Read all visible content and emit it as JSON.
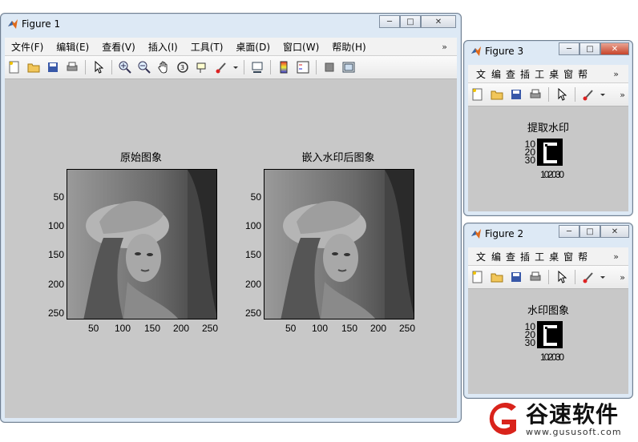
{
  "fig1": {
    "title": "Figure 1",
    "menu": [
      "文件(F)",
      "编辑(E)",
      "查看(V)",
      "插入(I)",
      "工具(T)",
      "桌面(D)",
      "窗口(W)",
      "帮助(H)"
    ],
    "menu_more": "»",
    "axes_left_title": "原始图象",
    "axes_right_title": "嵌入水印后图象",
    "y_ticks": [
      "50",
      "100",
      "150",
      "200",
      "250"
    ],
    "x_ticks": [
      "50",
      "100",
      "150",
      "200",
      "250"
    ]
  },
  "fig3": {
    "title": "Figure 3",
    "menu": [
      "文",
      "编",
      "查",
      "插",
      "工",
      "桌",
      "窗",
      "帮"
    ],
    "menu_more": "»",
    "toolbar_more": "»",
    "axes_title": "提取水印",
    "y_ticks": [
      "10",
      "20",
      "30"
    ],
    "x_ticks": "102030"
  },
  "fig2": {
    "title": "Figure 2",
    "menu": [
      "文",
      "编",
      "查",
      "插",
      "工",
      "桌",
      "窗",
      "帮"
    ],
    "menu_more": "»",
    "toolbar_more": "»",
    "axes_title": "水印图象",
    "y_ticks": [
      "10",
      "20",
      "30"
    ],
    "x_ticks": "102030"
  },
  "watermark_site": {
    "brand": "谷速软件",
    "url": "www.gususoft.com"
  },
  "colors": {
    "canvas": "#c8c8c8",
    "brand_red": "#d9231b",
    "close_red": "#c7452b"
  }
}
